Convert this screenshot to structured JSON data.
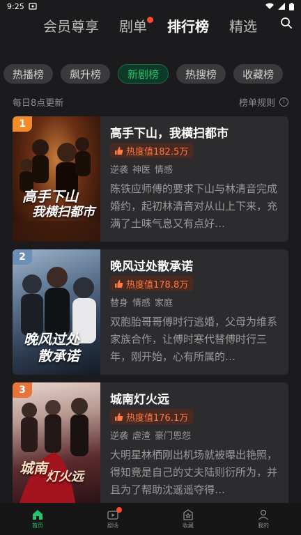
{
  "status": {
    "time": "9:25"
  },
  "top_nav": {
    "tabs": [
      {
        "label": "会员尊享"
      },
      {
        "label": "剧单"
      },
      {
        "label": "排行榜"
      },
      {
        "label": "精选"
      }
    ],
    "active_index": 2
  },
  "subtabs": [
    {
      "label": "热播榜"
    },
    {
      "label": "飙升榜"
    },
    {
      "label": "新剧榜"
    },
    {
      "label": "热搜榜"
    },
    {
      "label": "收藏榜"
    }
  ],
  "active_subtab": 2,
  "info": {
    "update_text": "每日8点更新",
    "rules_label": "榜单规则",
    "rules_icon": "i"
  },
  "items": [
    {
      "rank": "1",
      "title": "高手下山，我横扫都市",
      "heat": "热度值182.5万",
      "tags": [
        "逆袭",
        "神医",
        "情感"
      ],
      "description": "陈铁应师傅的要求下山与林清音完成婚约，起初林清音对从山上下来，充满了土味气息又有点好…",
      "poster_text": [
        "高手下山",
        "我横扫都市"
      ],
      "badge_color": "#f28c28"
    },
    {
      "rank": "2",
      "title": "晚风过处散承诺",
      "heat": "热度值178.8万",
      "tags": [
        "替身",
        "情感",
        "家庭"
      ],
      "description": "双胞胎哥哥傅时行逃婚，父母为维系家族合作，让傅时寒代替傅时行三年，刚开始，心有所属的…",
      "poster_text": [
        "晚风过处",
        "散承诺"
      ],
      "badge_color": "#6c8fb5"
    },
    {
      "rank": "3",
      "title": "城南灯火远",
      "heat": "热度值176.1万",
      "tags": [
        "逆袭",
        "虐渣",
        "豪门恩怨"
      ],
      "description": "大明星林栖刚出机场就被曝出艳照，得知竟是自己的丈夫陆则衍所为，并且为了帮助沈遥遥夺得…",
      "poster_text": [
        "城南",
        "灯火远"
      ],
      "badge_color": "#e8743a"
    }
  ],
  "bottom_nav": [
    {
      "label": "首页"
    },
    {
      "label": "剧场"
    },
    {
      "label": "收藏"
    },
    {
      "label": "我的"
    }
  ],
  "colors": {
    "accent": "#25c26a",
    "heat": "#ff7a45",
    "background": "#1b1b1d",
    "card": "#2c2c2e"
  }
}
